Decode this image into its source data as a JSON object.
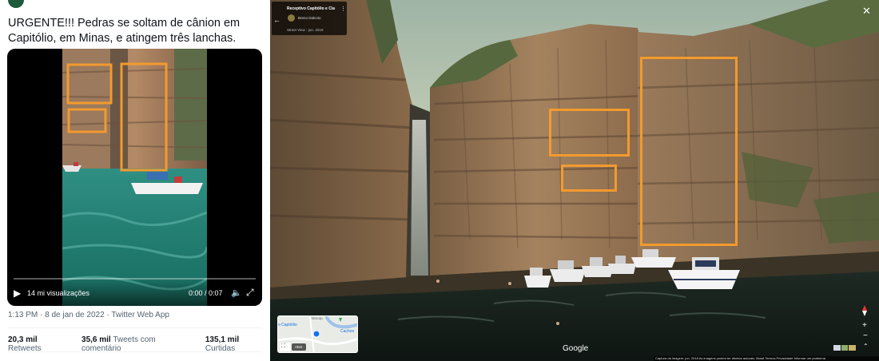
{
  "tweet": {
    "text": "URGENTE!!! Pedras se soltam de cânion em Capitólio, em Minas, e atingem três lanchas.",
    "video": {
      "views": "14 mi visualizações",
      "time": "0:00 / 0:07"
    },
    "meta": "1:13 PM · 8 de jan de 2022 · Twitter Web App",
    "stats": [
      {
        "count": "20,3 mil",
        "label": "Retweets"
      },
      {
        "count": "35,6 mil",
        "label": "Tweets com comentário"
      },
      {
        "count": "135,1 mil",
        "label": "Curtidas"
      }
    ]
  },
  "streetview": {
    "place_title": "Receptivo Capitólio e Cia",
    "author": "Breno Dalcoto",
    "date_label": "Street View - jun. 2018",
    "minimap": {
      "label_1": "o Capitólio",
      "label_2": "Cachoe",
      "label_3": "Discop",
      "expand_label": "Abrir"
    },
    "google_logo": "Google",
    "footer": "Captura da imagem: jun. 2018   As imagens podem ter direitos autorais.   Brasil   Termos   Privacidade   Informar um problema"
  },
  "colors": {
    "annotation": "#f39a2e",
    "twitter_text": "#0f1419",
    "twitter_muted": "#536471"
  }
}
